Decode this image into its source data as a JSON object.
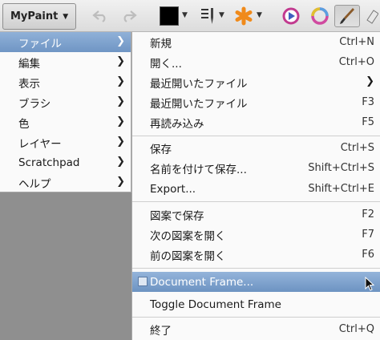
{
  "app_button": {
    "label": "MyPaint"
  },
  "main_menu": {
    "items": [
      {
        "label": "ファイル"
      },
      {
        "label": "編集"
      },
      {
        "label": "表示"
      },
      {
        "label": "ブラシ"
      },
      {
        "label": "色"
      },
      {
        "label": "レイヤー"
      },
      {
        "label": "Scratchpad"
      },
      {
        "label": "ヘルプ"
      }
    ]
  },
  "file_menu": {
    "items": [
      {
        "label": "新規",
        "accel": "Ctrl+N"
      },
      {
        "label": "開く...",
        "accel": "Ctrl+O"
      },
      {
        "label": "最近開いたファイル",
        "accel": ""
      },
      {
        "label": "最近開いたファイル",
        "accel": "F3"
      },
      {
        "label": "再読み込み",
        "accel": "F5"
      },
      {
        "label": "保存",
        "accel": "Ctrl+S"
      },
      {
        "label": "名前を付けて保存...",
        "accel": "Shift+Ctrl+S"
      },
      {
        "label": "Export...",
        "accel": "Shift+Ctrl+E"
      },
      {
        "label": "図案で保存",
        "accel": "F2"
      },
      {
        "label": "次の図案を開く",
        "accel": "F7"
      },
      {
        "label": "前の図案を開く",
        "accel": "F6"
      },
      {
        "label": "Document Frame...",
        "accel": ""
      },
      {
        "label": "Toggle Document Frame",
        "accel": ""
      },
      {
        "label": "終了",
        "accel": "Ctrl+Q"
      }
    ]
  },
  "colors": {
    "highlight": "#7fa3cf",
    "menu_bg": "#fafafa",
    "canvas_bg": "#8f8f8f",
    "brush_color": "#000000",
    "symmetry_icon": "#f08a1a"
  }
}
